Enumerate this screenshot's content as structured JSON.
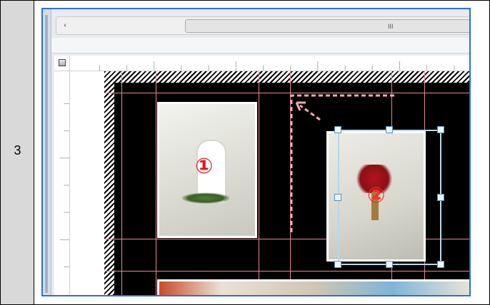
{
  "step": {
    "number": "3"
  },
  "scrollbar": {
    "left_arrow": "‹",
    "grip": "III"
  },
  "photos": [
    {
      "id": "photo-1",
      "number": "①"
    },
    {
      "id": "photo-2",
      "number": "②"
    }
  ],
  "colors": {
    "screenshot_border": "#2d6fd6",
    "guide": "#e48a93",
    "badge": "#e1161f",
    "arrow": "#f0aab0",
    "selection": "#b9d6ea"
  },
  "icons": {
    "corner": "ruler-corner-icon",
    "scroll_left": "chevron-left-icon",
    "drag": "drag-arrow-icon"
  }
}
